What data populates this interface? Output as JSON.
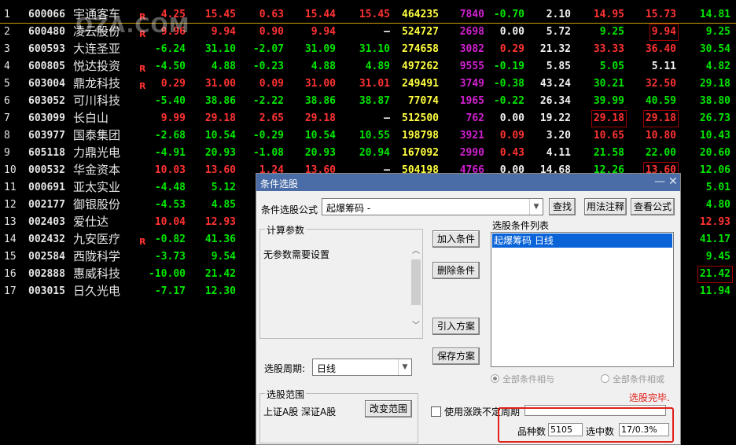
{
  "watermark": "OZA.COM",
  "rows": [
    {
      "idx": "1",
      "code": "600066",
      "name": "宇通客车",
      "r": "R",
      "v": [
        "4.25",
        "15.45",
        "0.63",
        "15.44",
        "15.45",
        "464235",
        "7840",
        "-0.70",
        "2.10",
        "14.95",
        "15.73",
        "14.81"
      ],
      "c": [
        "red",
        "red",
        "red",
        "red",
        "red",
        "yellow",
        "purple",
        "green",
        "white",
        "red",
        "red",
        "green"
      ],
      "box": []
    },
    {
      "idx": "2",
      "code": "600480",
      "name": "凌云股份",
      "r": "R",
      "v": [
        "9.96",
        "9.94",
        "0.90",
        "9.94",
        "—",
        "524727",
        "2698",
        "0.00",
        "5.72",
        "9.25",
        "9.94",
        "9.25"
      ],
      "c": [
        "red",
        "red",
        "red",
        "red",
        "white",
        "yellow",
        "purple",
        "white",
        "white",
        "green",
        "red",
        "green"
      ],
      "box": [
        10
      ]
    },
    {
      "idx": "3",
      "code": "600593",
      "name": "大连圣亚",
      "r": "",
      "v": [
        "-6.24",
        "31.10",
        "-2.07",
        "31.09",
        "31.10",
        "274658",
        "3082",
        "0.29",
        "21.32",
        "33.33",
        "36.40",
        "30.54"
      ],
      "c": [
        "green",
        "green",
        "green",
        "green",
        "green",
        "yellow",
        "purple",
        "red",
        "white",
        "red",
        "red",
        "green"
      ],
      "box": []
    },
    {
      "idx": "4",
      "code": "600805",
      "name": "悦达投资",
      "r": "R",
      "v": [
        "-4.50",
        "4.88",
        "-0.23",
        "4.88",
        "4.89",
        "497262",
        "9555",
        "-0.19",
        "5.85",
        "5.05",
        "5.11",
        "4.82"
      ],
      "c": [
        "green",
        "green",
        "green",
        "green",
        "green",
        "yellow",
        "purple",
        "green",
        "white",
        "green",
        "white",
        "green"
      ],
      "box": []
    },
    {
      "idx": "5",
      "code": "603004",
      "name": "鼎龙科技",
      "r": "R",
      "v": [
        "0.29",
        "31.00",
        "0.09",
        "31.00",
        "31.01",
        "249491",
        "3749",
        "-0.38",
        "43.24",
        "30.21",
        "32.50",
        "29.18"
      ],
      "c": [
        "red",
        "red",
        "red",
        "red",
        "red",
        "yellow",
        "purple",
        "green",
        "white",
        "green",
        "red",
        "green"
      ],
      "box": []
    },
    {
      "idx": "6",
      "code": "603052",
      "name": "可川科技",
      "r": "",
      "v": [
        "-5.40",
        "38.86",
        "-2.22",
        "38.86",
        "38.87",
        "77074",
        "1965",
        "-0.22",
        "26.34",
        "39.99",
        "40.59",
        "38.80"
      ],
      "c": [
        "green",
        "green",
        "green",
        "green",
        "green",
        "yellow",
        "purple",
        "green",
        "white",
        "green",
        "green",
        "green"
      ],
      "box": []
    },
    {
      "idx": "7",
      "code": "603099",
      "name": "长白山",
      "r": "",
      "v": [
        "9.99",
        "29.18",
        "2.65",
        "29.18",
        "—",
        "512500",
        "762",
        "0.00",
        "19.22",
        "29.18",
        "29.18",
        "26.73"
      ],
      "c": [
        "red",
        "red",
        "red",
        "red",
        "white",
        "yellow",
        "purple",
        "white",
        "white",
        "red",
        "red",
        "green"
      ],
      "box": [
        9,
        10
      ]
    },
    {
      "idx": "8",
      "code": "603977",
      "name": "国泰集团",
      "r": "",
      "v": [
        "-2.68",
        "10.54",
        "-0.29",
        "10.54",
        "10.55",
        "198798",
        "3921",
        "0.09",
        "3.20",
        "10.65",
        "10.80",
        "10.43"
      ],
      "c": [
        "green",
        "green",
        "green",
        "green",
        "green",
        "yellow",
        "purple",
        "red",
        "white",
        "red",
        "red",
        "green"
      ],
      "box": []
    },
    {
      "idx": "9",
      "code": "605118",
      "name": "力鼎光电",
      "r": "",
      "v": [
        "-4.91",
        "20.93",
        "-1.08",
        "20.93",
        "20.94",
        "167092",
        "2990",
        "0.43",
        "4.11",
        "21.58",
        "22.00",
        "20.60"
      ],
      "c": [
        "green",
        "green",
        "green",
        "green",
        "green",
        "yellow",
        "purple",
        "red",
        "white",
        "green",
        "green",
        "green"
      ],
      "box": []
    },
    {
      "idx": "10",
      "code": "000532",
      "name": "华金资本",
      "r": "",
      "v": [
        "10.03",
        "13.60",
        "1.24",
        "13.60",
        "—",
        "504198",
        "4766",
        "0.00",
        "14.68",
        "12.26",
        "13.60",
        "12.06"
      ],
      "c": [
        "red",
        "red",
        "red",
        "red",
        "white",
        "yellow",
        "purple",
        "white",
        "white",
        "green",
        "red",
        "green"
      ],
      "box": [
        10
      ]
    },
    {
      "idx": "11",
      "code": "000691",
      "name": "亚太实业",
      "r": "",
      "v": [
        "-4.48",
        "5.12",
        "",
        "",
        "",
        "",
        "",
        "",
        "",
        "",
        "",
        "5.01"
      ],
      "c": [
        "green",
        "green",
        "",
        "",
        "",
        "",
        "",
        "",
        "",
        "",
        "",
        "green"
      ],
      "box": []
    },
    {
      "idx": "12",
      "code": "002177",
      "name": "御银股份",
      "r": "",
      "v": [
        "-4.53",
        "4.85",
        "",
        "",
        "",
        "",
        "",
        "",
        "",
        "",
        "",
        "4.80"
      ],
      "c": [
        "green",
        "green",
        "",
        "",
        "",
        "",
        "",
        "",
        "",
        "",
        "",
        "green"
      ],
      "box": []
    },
    {
      "idx": "13",
      "code": "002403",
      "name": "爱仕达",
      "r": "",
      "v": [
        "10.04",
        "12.93",
        "",
        "",
        "",
        "",
        "",
        "",
        "",
        "",
        "",
        "12.93"
      ],
      "c": [
        "red",
        "red",
        "",
        "",
        "",
        "",
        "",
        "",
        "",
        "",
        "",
        "red"
      ],
      "box": []
    },
    {
      "idx": "14",
      "code": "002432",
      "name": "九安医疗",
      "r": "R",
      "v": [
        "-0.82",
        "41.36",
        "",
        "",
        "",
        "",
        "",
        "",
        "",
        "",
        "",
        "41.17"
      ],
      "c": [
        "green",
        "green",
        "",
        "",
        "",
        "",
        "",
        "",
        "",
        "",
        "",
        "green"
      ],
      "box": []
    },
    {
      "idx": "15",
      "code": "002584",
      "name": "西陇科学",
      "r": "",
      "v": [
        "-3.73",
        "9.54",
        "",
        "",
        "",
        "",
        "",
        "",
        "",
        "",
        "",
        "9.45"
      ],
      "c": [
        "green",
        "green",
        "",
        "",
        "",
        "",
        "",
        "",
        "",
        "",
        "",
        "green"
      ],
      "box": []
    },
    {
      "idx": "16",
      "code": "002888",
      "name": "惠威科技",
      "r": "",
      "v": [
        "-10.00",
        "21.42",
        "",
        "",
        "",
        "",
        "",
        "",
        "",
        "",
        "",
        "21.42"
      ],
      "c": [
        "green",
        "green",
        "",
        "",
        "",
        "",
        "",
        "",
        "",
        "",
        "",
        "green"
      ],
      "box": [
        11
      ]
    },
    {
      "idx": "17",
      "code": "003015",
      "name": "日久光电",
      "r": "",
      "v": [
        "-7.17",
        "12.30",
        "",
        "",
        "",
        "",
        "",
        "",
        "",
        "",
        "",
        "11.94"
      ],
      "c": [
        "green",
        "green",
        "",
        "",
        "",
        "",
        "",
        "",
        "",
        "",
        "",
        "green"
      ],
      "box": []
    }
  ],
  "dialog": {
    "title": "条件选股",
    "min_glyph": "—",
    "close_glyph": "✕",
    "formula_label": "条件选股公式",
    "formula_value": "起爆筹码  -",
    "find_btn": "查找",
    "usage_btn": "用法注释",
    "view_formula_btn": "查看公式",
    "params_group": "计算参数",
    "params_text": "无参数需要设置",
    "add_condition": "加入条件",
    "delete_condition": "删除条件",
    "import_plan": "引入方案",
    "save_plan": "保存方案",
    "condition_list_label": "选股条件列表",
    "condition_item": "起爆筹码  日线",
    "period_label": "选股周期:",
    "period_value": "日线",
    "radio_and": "全部条件相与",
    "radio_or": "全部条件相或",
    "range_group": "选股范围",
    "range_value": "上证A股 深证A股",
    "change_range_btn": "改变范围",
    "use_change_label": "使用涨跌不定周期",
    "done_text": "选股完毕.",
    "count_label": "品种数",
    "count_value": "5105",
    "selected_label": "选中数",
    "selected_value": "17/0.3%"
  },
  "colors": {
    "red": "#ff3232",
    "green": "#00e600",
    "yellow": "#ffff40",
    "purple": "#d020d0",
    "title_bar": "#4a6da7",
    "highlight": "#e0201a"
  }
}
